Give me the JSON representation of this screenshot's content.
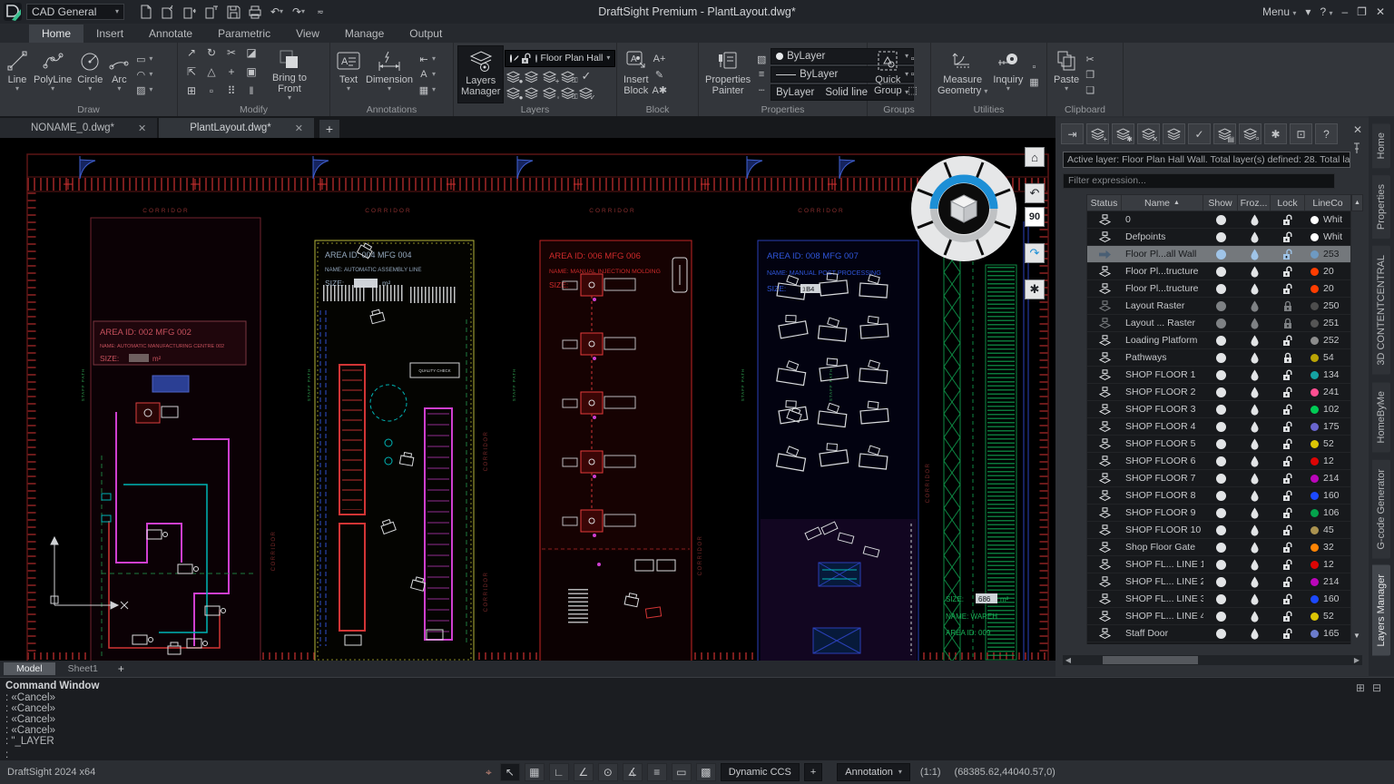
{
  "title_bar": {
    "workspace": "CAD General",
    "title": "DraftSight Premium - PlantLayout.dwg*",
    "menu_label": "Menu",
    "help_label": "?"
  },
  "ribbon": {
    "tabs": [
      "Home",
      "Insert",
      "Annotate",
      "Parametric",
      "View",
      "Manage",
      "Output"
    ],
    "active_tab": "Home",
    "draw": {
      "label": "Draw",
      "line": "Line",
      "polyline": "PolyLine",
      "circle": "Circle",
      "arc": "Arc",
      "icons": [
        {
          "name": "rectangle-icon",
          "g": "▭"
        },
        {
          "name": "ellipse-icon",
          "g": "◠"
        },
        {
          "name": "hatch-icon",
          "g": "▨"
        }
      ]
    },
    "modify": {
      "label": "Modify",
      "bring_to_front": "Bring to Front",
      "icons": [
        {
          "name": "move-icon",
          "g": "↗"
        },
        {
          "name": "rotate-icon",
          "g": "↻"
        },
        {
          "name": "trim-icon",
          "g": "✂"
        },
        {
          "name": "erase-icon",
          "g": "◪"
        },
        {
          "name": "copy-icon",
          "g": "⇱"
        },
        {
          "name": "mirror-icon",
          "g": "△"
        },
        {
          "name": "fillet-icon",
          "g": "+"
        },
        {
          "name": "offset-icon",
          "g": "▣"
        },
        {
          "name": "pattern-icon",
          "g": "⊞"
        },
        {
          "name": "scale-icon",
          "g": "▫"
        },
        {
          "name": "explode-icon",
          "g": "⠿"
        },
        {
          "name": "stretch-icon",
          "g": "ǁ"
        }
      ]
    },
    "annotations": {
      "label": "Annotations",
      "text": "Text",
      "dimension": "Dimension",
      "icons": [
        {
          "name": "dimension-boundary-icon",
          "g": "⇤"
        },
        {
          "name": "leader-icon",
          "g": "A"
        },
        {
          "name": "table-icon",
          "g": "▦"
        }
      ]
    },
    "layers": {
      "label": "Layers",
      "manager_line1": "Layers",
      "manager_line2": "Manager",
      "active_layer": "Floor Plan Hall",
      "tools": [
        {
          "name": "hide-layer-icon",
          "ov": "●"
        },
        {
          "name": "isolate-layer-icon",
          "ov": ""
        },
        {
          "name": "add-layer-icon",
          "ov": "+"
        },
        {
          "name": "lock-layer-icon",
          "ov": "⚿"
        },
        {
          "name": "activate-check-icon",
          "ov": "✓"
        },
        {
          "name": "show-layer-icon",
          "ov": "●"
        },
        {
          "name": "unisolate-layer-icon",
          "ov": ""
        },
        {
          "name": "thaw-layer-icon",
          "ov": "◦"
        },
        {
          "name": "unlock-layer-icon",
          "ov": "⚿"
        },
        {
          "name": "layer-state-icon",
          "ov": "✓"
        }
      ]
    },
    "block": {
      "label": "Block",
      "insert_line1": "Insert",
      "insert_line2": "Block",
      "icons": [
        {
          "name": "define-block-icon",
          "g": "A+"
        },
        {
          "name": "edit-block-icon",
          "g": "✎"
        },
        {
          "name": "attribute-icon",
          "g": "A✱"
        }
      ]
    },
    "properties": {
      "label": "Properties",
      "painter_line1": "Properties",
      "painter_line2": "Painter",
      "color": "ByLayer",
      "linetype": "ByLayer",
      "lineweight": "ByLayer",
      "linestyle": "Solid line",
      "icons": [
        {
          "name": "color-swatch-icon",
          "g": "▧"
        },
        {
          "name": "lineweight-icon",
          "g": "≡"
        },
        {
          "name": "linestyle-icon",
          "g": "┄"
        }
      ]
    },
    "groups_grp": {
      "label": "Groups",
      "quick_line1": "Quick",
      "quick_line2": "Group",
      "icons": [
        {
          "name": "group-edit-icon",
          "g": "▫"
        },
        {
          "name": "ungroup-icon",
          "g": "▫"
        },
        {
          "name": "group-select-icon",
          "g": "⬚"
        }
      ]
    },
    "utilities": {
      "label": "Utilities",
      "measure_line1": "Measure",
      "measure_line2": "Geometry",
      "inquiry": "Inquiry",
      "icons": [
        {
          "name": "smart-select-icon",
          "g": "▫"
        },
        {
          "name": "calculator-icon",
          "g": "▦"
        }
      ]
    },
    "clipboard": {
      "label": "Clipboard",
      "paste": "Paste",
      "icons": [
        {
          "name": "cut-icon",
          "g": "✂"
        },
        {
          "name": "copy-icon",
          "g": "❐"
        },
        {
          "name": "paste-special-icon",
          "g": "❏"
        }
      ]
    }
  },
  "doc_tabs": {
    "tabs": [
      {
        "label": "NONAME_0.dwg*",
        "active": false
      },
      {
        "label": "PlantLayout.dwg*",
        "active": true
      }
    ],
    "add": "+"
  },
  "drawing": {
    "corridor": "CORRIDOR",
    "staff_path": "STAFF PATH",
    "quality_check": "QUALITY CHECK",
    "zone2_labels": {
      "id": "AREA ID:  002 MFG 002",
      "name": "NAME: AUTOMATIC MANUFACTURING CENTRE 002",
      "size": "SIZE:",
      "unit": "m²"
    },
    "zone4_labels": {
      "id": "AREA ID:  004 MFG 004",
      "name": "NAME: AUTOMATIC ASSEMBLY LINE",
      "size": "SIZE:",
      "unit": "m²"
    },
    "zone6_labels": {
      "id": "AREA ID:  006 MFG 006",
      "name": "NAME: MANUAL INJECTION MOLDING",
      "size": "SIZE:"
    },
    "zone8_labels": {
      "id": "AREA ID:  008 MFG 007",
      "name": "NAME: MANUAL POST PROCESSING",
      "size": "SIZE:",
      "size_val": "1B4",
      "unit": "m²"
    },
    "zone9_labels": {
      "size": "SIZE:",
      "size_val": "686",
      "unit": "m²",
      "name": "NAME: WAREH",
      "id": "AREA ID:  009"
    },
    "viewcube": {
      "angle": "90"
    }
  },
  "sheet_tabs": {
    "model": "Model",
    "sheet1": "Sheet1",
    "add": "+"
  },
  "command_window": {
    "title": "Command Window",
    "lines": [
      ": «Cancel»",
      ": «Cancel»",
      ": «Cancel»",
      ": «Cancel»",
      ": \"_LAYER"
    ],
    "prompt": ":"
  },
  "status_bar": {
    "app_version": "DraftSight 2024 x64",
    "snap_icon": {
      "name": "snap-status-icon",
      "g": "⌖"
    },
    "buttons": [
      {
        "name": "pointer-mode-button",
        "g": "↖",
        "active": true
      },
      {
        "name": "grid-snap-button",
        "g": "▦"
      },
      {
        "name": "ortho-button",
        "g": "∟"
      },
      {
        "name": "polar-button",
        "g": "∠"
      },
      {
        "name": "esnap-button",
        "g": "⊙"
      },
      {
        "name": "etrack-button",
        "g": "∡"
      },
      {
        "name": "lineweight-button",
        "g": "≡"
      },
      {
        "name": "print-style-button",
        "g": "▭"
      },
      {
        "name": "fill-button",
        "g": "▩"
      }
    ],
    "dynamic_ccs": "Dynamic CCS",
    "add": "+",
    "annotation": "Annotation",
    "scale": "(1:1)",
    "coordinates": "(68385.62,44040.57,0)"
  },
  "layers_panel": {
    "active_layer_info": "Active layer: Floor Plan Hall Wall. Total layer(s) defined: 28. Total la",
    "filter_placeholder": "Filter expression...",
    "columns": {
      "status": "Status",
      "name": "Name",
      "show": "Show",
      "frozen": "Froz...",
      "lock": "Lock",
      "linecolor": "LineCo"
    },
    "toolbar": [
      {
        "name": "dock-panel-button",
        "g": "⇥"
      },
      {
        "name": "new-layer-button",
        "ov": "+"
      },
      {
        "name": "new-vp-layer-button",
        "ov": "✱"
      },
      {
        "name": "delete-layer-button",
        "ov": "✕"
      },
      {
        "name": "merge-layer-button",
        "ov": ""
      },
      {
        "name": "activate-layer-button",
        "g": "✓"
      },
      {
        "name": "layer-properties-button",
        "ov": "▤"
      },
      {
        "name": "layer-search-button",
        "ov": "⌕"
      },
      {
        "name": "settings-button",
        "g": "✱"
      },
      {
        "name": "layer-states-button",
        "g": "⊡"
      },
      {
        "name": "help-button",
        "g": "?"
      }
    ],
    "rows": [
      {
        "name": "0",
        "num": "Whit",
        "color": "#ffffff"
      },
      {
        "name": "Defpoints",
        "num": "Whit",
        "color": "#ffffff"
      },
      {
        "name": "Floor Pl...all Wall",
        "num": "253",
        "color": "#6e9ac2",
        "selected": true
      },
      {
        "name": "Floor Pl...tructure",
        "num": "20",
        "color": "#ff3d00"
      },
      {
        "name": "Floor Pl...tructure",
        "num": "20",
        "color": "#ff3d00"
      },
      {
        "name": "Layout Raster",
        "num": "250",
        "color": "#4d4d4d",
        "locked": true,
        "dim": true
      },
      {
        "name": "Layout ... Raster",
        "num": "251",
        "color": "#555555",
        "locked": true,
        "dim": true
      },
      {
        "name": "Loading Platform",
        "num": "252",
        "color": "#8c8c8c"
      },
      {
        "name": "Pathways",
        "num": "54",
        "color": "#baa405",
        "locked": true
      },
      {
        "name": "SHOP FLOOR 1",
        "num": "134",
        "color": "#15a3a3"
      },
      {
        "name": "SHOP FLOOR 2",
        "num": "241",
        "color": "#ff4f92"
      },
      {
        "name": "SHOP FLOOR 3",
        "num": "102",
        "color": "#00cc55"
      },
      {
        "name": "SHOP FLOOR 4",
        "num": "175",
        "color": "#6a66cf"
      },
      {
        "name": "SHOP FLOOR 5",
        "num": "52",
        "color": "#dcc505"
      },
      {
        "name": "SHOP FLOOR 6",
        "num": "12",
        "color": "#dd0505"
      },
      {
        "name": "SHOP FLOOR 7",
        "num": "214",
        "color": "#bb06bb"
      },
      {
        "name": "SHOP FLOOR 8",
        "num": "160",
        "color": "#1c49ff"
      },
      {
        "name": "SHOP FLOOR 9",
        "num": "106",
        "color": "#04a44c"
      },
      {
        "name": "SHOP FLOOR 10",
        "num": "45",
        "color": "#ab9350"
      },
      {
        "name": "Shop Floor Gate",
        "num": "32",
        "color": "#ff8505"
      },
      {
        "name": "SHOP FL... LINE 1",
        "num": "12",
        "color": "#dd0505"
      },
      {
        "name": "SHOP FL... LINE 2",
        "num": "214",
        "color": "#bb06bb"
      },
      {
        "name": "SHOP FL... LINE 3",
        "num": "160",
        "color": "#1c49ff"
      },
      {
        "name": "SHOP FL... LINE 4",
        "num": "52",
        "color": "#dcc505"
      },
      {
        "name": "Staff Door",
        "num": "165",
        "color": "#6b7ccc"
      }
    ]
  },
  "right_tabs": [
    {
      "label": "Home",
      "active": false
    },
    {
      "label": "Properties",
      "active": false
    },
    {
      "label": "3D CONTENTCENTRAL",
      "active": false
    },
    {
      "label": "HomeByMe",
      "active": false
    },
    {
      "label": "G-code Generator",
      "active": false
    },
    {
      "label": "Layers Manager",
      "active": true
    }
  ]
}
